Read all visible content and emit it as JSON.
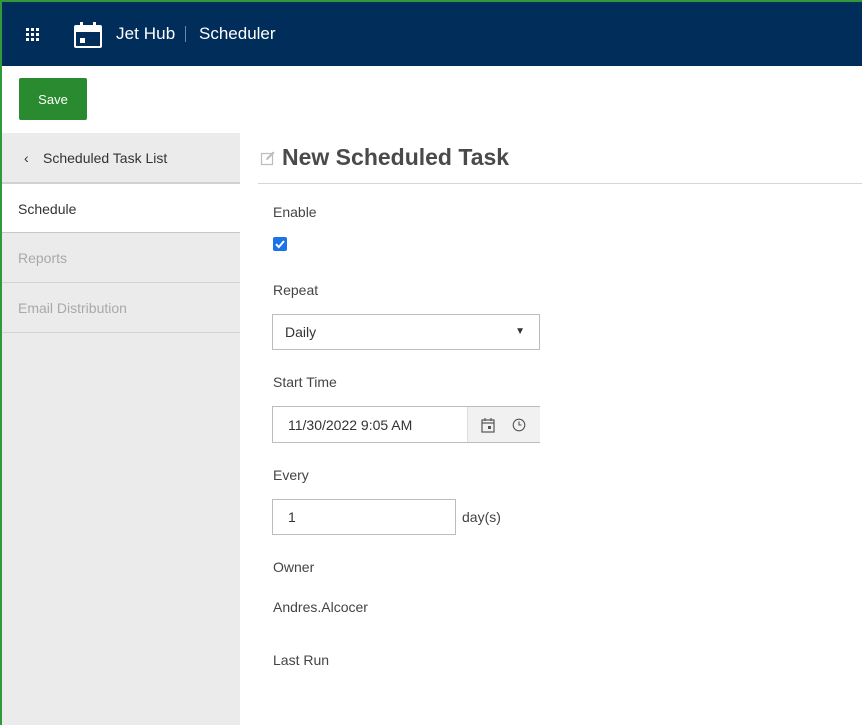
{
  "header": {
    "app_name": "Jet Hub",
    "module_name": "Scheduler"
  },
  "toolbar": {
    "save_label": "Save"
  },
  "sidebar": {
    "items": [
      {
        "label": "Scheduled Task List"
      },
      {
        "label": "Schedule"
      },
      {
        "label": "Reports"
      },
      {
        "label": "Email Distribution"
      }
    ]
  },
  "main": {
    "title": "New Scheduled Task",
    "enable": {
      "label": "Enable",
      "checked": true
    },
    "repeat": {
      "label": "Repeat",
      "value": "Daily"
    },
    "start_time": {
      "label": "Start Time",
      "value": "11/30/2022 9:05 AM"
    },
    "every": {
      "label": "Every",
      "value": "1",
      "unit": "day(s)"
    },
    "owner": {
      "label": "Owner",
      "value": "Andres.Alcocer"
    },
    "last_run": {
      "label": "Last Run"
    }
  },
  "colors": {
    "header_bg": "#002d5a",
    "save_button": "#2a8a2f",
    "frame_border": "#2e9a3a",
    "checkbox": "#1a73e8",
    "sidebar_bg": "#ebebeb"
  },
  "icons": [
    "apps-grid-icon",
    "calendar-icon",
    "chevron-left-icon",
    "edit-icon",
    "checkmark-icon",
    "caret-down-icon",
    "calendar-icon",
    "clock-icon"
  ]
}
